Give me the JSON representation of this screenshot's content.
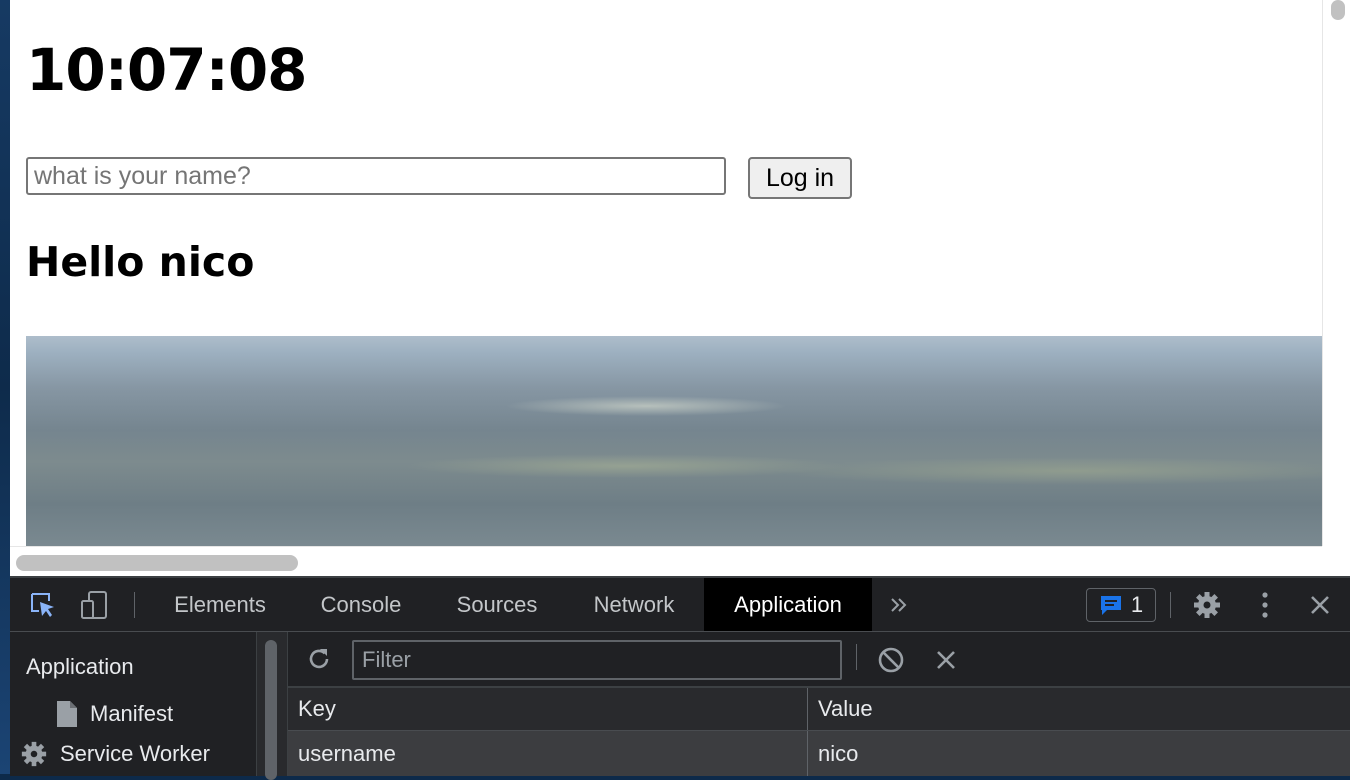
{
  "page": {
    "clock": "10:07:08",
    "login": {
      "placeholder": "what is your name?",
      "button_label": "Log in"
    },
    "greeting": "Hello nico"
  },
  "devtools": {
    "tabs": [
      {
        "label": "Elements",
        "active": false
      },
      {
        "label": "Console",
        "active": false
      },
      {
        "label": "Sources",
        "active": false
      },
      {
        "label": "Network",
        "active": false
      },
      {
        "label": "Application",
        "active": true
      }
    ],
    "more_tabs_icon": "chevron-double-right-icon",
    "issues_count": "1",
    "sidebar": {
      "heading": "Application",
      "items": [
        {
          "label": "Manifest",
          "icon": "file-icon"
        },
        {
          "label": "Service Worker",
          "icon": "gear-icon"
        }
      ]
    },
    "storage": {
      "filter_placeholder": "Filter",
      "columns": [
        "Key",
        "Value"
      ],
      "rows": [
        {
          "key": "username",
          "value": "nico"
        }
      ]
    },
    "colors": {
      "panel_bg": "#202124",
      "active_tab_bg": "#000000",
      "selected_row_bg": "#3c3d40",
      "issue_icon": "#1a73e8"
    }
  }
}
